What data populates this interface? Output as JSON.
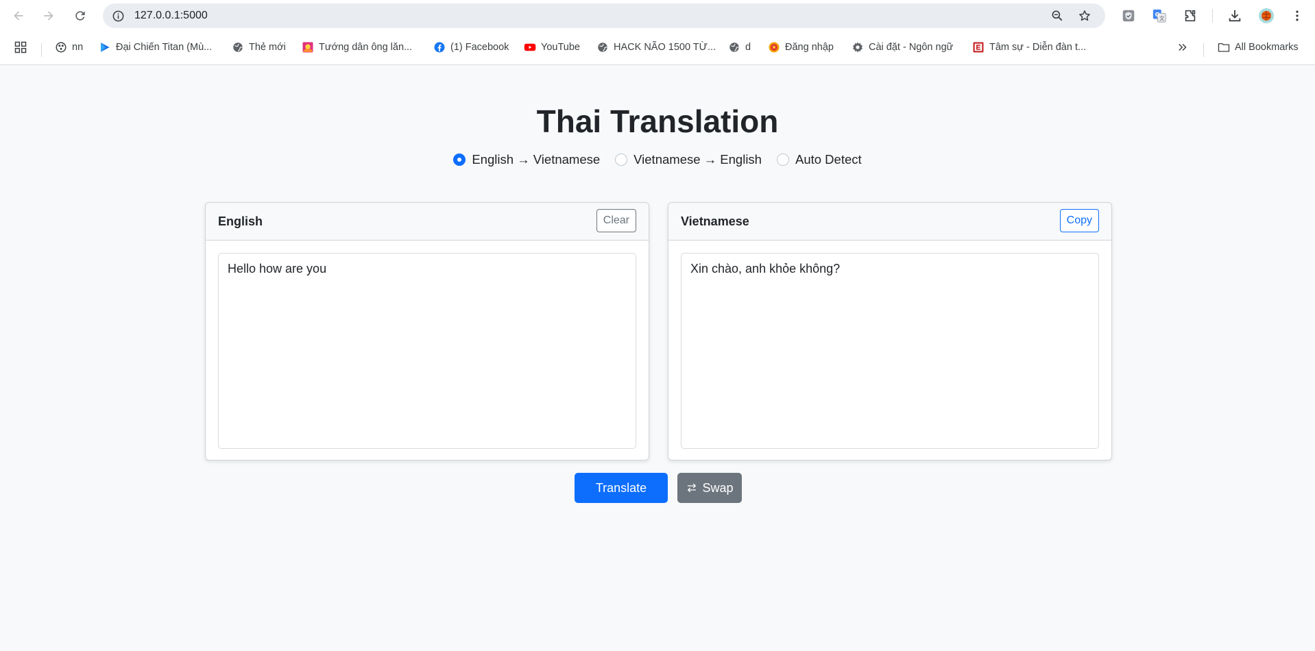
{
  "browser": {
    "url": "127.0.0.1:5000",
    "bookmarks": [
      {
        "label": "nn",
        "icon": "film-reel-icon"
      },
      {
        "label": "Đại Chiến Titan (Mù...",
        "icon": "play-triangle-icon"
      },
      {
        "label": "Thẻ mới",
        "icon": "globe-icon"
      },
      {
        "label": "Tướng dân ông lăn...",
        "icon": "sun-image-icon"
      },
      {
        "label": "(1) Facebook",
        "icon": "facebook-icon"
      },
      {
        "label": "YouTube",
        "icon": "youtube-icon"
      },
      {
        "label": "HACK NÃO 1500 TỪ...",
        "icon": "globe-icon"
      },
      {
        "label": "d",
        "icon": "globe-icon"
      },
      {
        "label": "Đăng nhập",
        "icon": "emblem-icon"
      },
      {
        "label": "Cài đặt - Ngôn ngữ",
        "icon": "gear-icon"
      },
      {
        "label": "Tâm sự - Diễn đàn t...",
        "icon": "forum-e-icon"
      }
    ],
    "all_bookmarks": "All Bookmarks"
  },
  "page": {
    "title": "Thai Translation",
    "modes": [
      {
        "label": "English → Vietnamese",
        "selected": true
      },
      {
        "label": "Vietnamese → English",
        "selected": false
      },
      {
        "label": "Auto Detect",
        "selected": false
      }
    ],
    "source": {
      "title": "English",
      "button": "Clear",
      "text": "Hello how are you"
    },
    "target": {
      "title": "Vietnamese",
      "button": "Copy",
      "text": "Xin chào, anh khỏe không?"
    },
    "translate_label": "Translate",
    "swap_label": "Swap"
  },
  "colors": {
    "primary": "#0d6efd",
    "secondary": "#6c757d",
    "background": "#f8f9fa"
  }
}
